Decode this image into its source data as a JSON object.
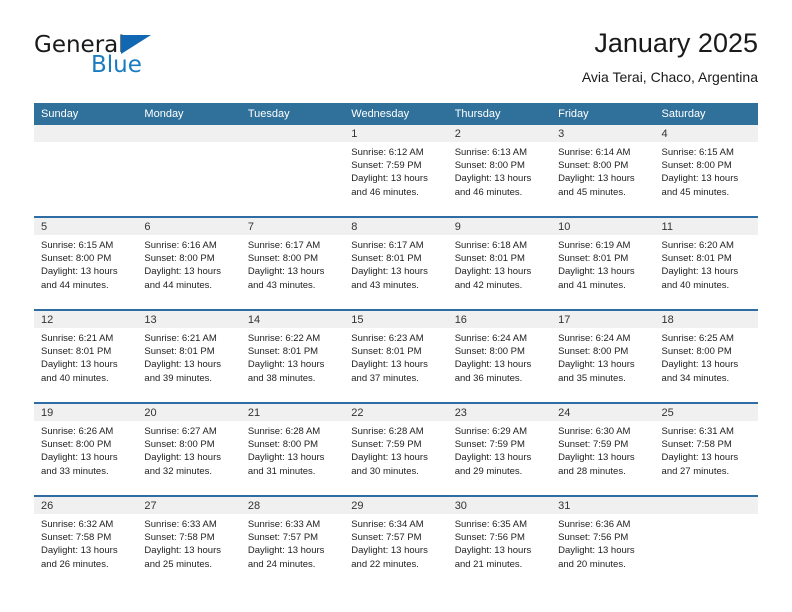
{
  "brand": {
    "name_part1": "General",
    "name_part2": "Blue",
    "accent_color": "#1167b1"
  },
  "header": {
    "title": "January 2025",
    "subtitle": "Avia Terai, Chaco, Argentina"
  },
  "theme": {
    "header_bg": "#30719b",
    "row_divider": "#2e6da4",
    "daynum_bg": "#f0f0f0"
  },
  "weekday_headers": [
    "Sunday",
    "Monday",
    "Tuesday",
    "Wednesday",
    "Thursday",
    "Friday",
    "Saturday"
  ],
  "weeks": [
    [
      {
        "day": "",
        "sunrise": "",
        "sunset": "",
        "daylight_line1": "",
        "daylight_line2": ""
      },
      {
        "day": "",
        "sunrise": "",
        "sunset": "",
        "daylight_line1": "",
        "daylight_line2": ""
      },
      {
        "day": "",
        "sunrise": "",
        "sunset": "",
        "daylight_line1": "",
        "daylight_line2": ""
      },
      {
        "day": "1",
        "sunrise": "Sunrise: 6:12 AM",
        "sunset": "Sunset: 7:59 PM",
        "daylight_line1": "Daylight: 13 hours",
        "daylight_line2": "and 46 minutes."
      },
      {
        "day": "2",
        "sunrise": "Sunrise: 6:13 AM",
        "sunset": "Sunset: 8:00 PM",
        "daylight_line1": "Daylight: 13 hours",
        "daylight_line2": "and 46 minutes."
      },
      {
        "day": "3",
        "sunrise": "Sunrise: 6:14 AM",
        "sunset": "Sunset: 8:00 PM",
        "daylight_line1": "Daylight: 13 hours",
        "daylight_line2": "and 45 minutes."
      },
      {
        "day": "4",
        "sunrise": "Sunrise: 6:15 AM",
        "sunset": "Sunset: 8:00 PM",
        "daylight_line1": "Daylight: 13 hours",
        "daylight_line2": "and 45 minutes."
      }
    ],
    [
      {
        "day": "5",
        "sunrise": "Sunrise: 6:15 AM",
        "sunset": "Sunset: 8:00 PM",
        "daylight_line1": "Daylight: 13 hours",
        "daylight_line2": "and 44 minutes."
      },
      {
        "day": "6",
        "sunrise": "Sunrise: 6:16 AM",
        "sunset": "Sunset: 8:00 PM",
        "daylight_line1": "Daylight: 13 hours",
        "daylight_line2": "and 44 minutes."
      },
      {
        "day": "7",
        "sunrise": "Sunrise: 6:17 AM",
        "sunset": "Sunset: 8:00 PM",
        "daylight_line1": "Daylight: 13 hours",
        "daylight_line2": "and 43 minutes."
      },
      {
        "day": "8",
        "sunrise": "Sunrise: 6:17 AM",
        "sunset": "Sunset: 8:01 PM",
        "daylight_line1": "Daylight: 13 hours",
        "daylight_line2": "and 43 minutes."
      },
      {
        "day": "9",
        "sunrise": "Sunrise: 6:18 AM",
        "sunset": "Sunset: 8:01 PM",
        "daylight_line1": "Daylight: 13 hours",
        "daylight_line2": "and 42 minutes."
      },
      {
        "day": "10",
        "sunrise": "Sunrise: 6:19 AM",
        "sunset": "Sunset: 8:01 PM",
        "daylight_line1": "Daylight: 13 hours",
        "daylight_line2": "and 41 minutes."
      },
      {
        "day": "11",
        "sunrise": "Sunrise: 6:20 AM",
        "sunset": "Sunset: 8:01 PM",
        "daylight_line1": "Daylight: 13 hours",
        "daylight_line2": "and 40 minutes."
      }
    ],
    [
      {
        "day": "12",
        "sunrise": "Sunrise: 6:21 AM",
        "sunset": "Sunset: 8:01 PM",
        "daylight_line1": "Daylight: 13 hours",
        "daylight_line2": "and 40 minutes."
      },
      {
        "day": "13",
        "sunrise": "Sunrise: 6:21 AM",
        "sunset": "Sunset: 8:01 PM",
        "daylight_line1": "Daylight: 13 hours",
        "daylight_line2": "and 39 minutes."
      },
      {
        "day": "14",
        "sunrise": "Sunrise: 6:22 AM",
        "sunset": "Sunset: 8:01 PM",
        "daylight_line1": "Daylight: 13 hours",
        "daylight_line2": "and 38 minutes."
      },
      {
        "day": "15",
        "sunrise": "Sunrise: 6:23 AM",
        "sunset": "Sunset: 8:01 PM",
        "daylight_line1": "Daylight: 13 hours",
        "daylight_line2": "and 37 minutes."
      },
      {
        "day": "16",
        "sunrise": "Sunrise: 6:24 AM",
        "sunset": "Sunset: 8:00 PM",
        "daylight_line1": "Daylight: 13 hours",
        "daylight_line2": "and 36 minutes."
      },
      {
        "day": "17",
        "sunrise": "Sunrise: 6:24 AM",
        "sunset": "Sunset: 8:00 PM",
        "daylight_line1": "Daylight: 13 hours",
        "daylight_line2": "and 35 minutes."
      },
      {
        "day": "18",
        "sunrise": "Sunrise: 6:25 AM",
        "sunset": "Sunset: 8:00 PM",
        "daylight_line1": "Daylight: 13 hours",
        "daylight_line2": "and 34 minutes."
      }
    ],
    [
      {
        "day": "19",
        "sunrise": "Sunrise: 6:26 AM",
        "sunset": "Sunset: 8:00 PM",
        "daylight_line1": "Daylight: 13 hours",
        "daylight_line2": "and 33 minutes."
      },
      {
        "day": "20",
        "sunrise": "Sunrise: 6:27 AM",
        "sunset": "Sunset: 8:00 PM",
        "daylight_line1": "Daylight: 13 hours",
        "daylight_line2": "and 32 minutes."
      },
      {
        "day": "21",
        "sunrise": "Sunrise: 6:28 AM",
        "sunset": "Sunset: 8:00 PM",
        "daylight_line1": "Daylight: 13 hours",
        "daylight_line2": "and 31 minutes."
      },
      {
        "day": "22",
        "sunrise": "Sunrise: 6:28 AM",
        "sunset": "Sunset: 7:59 PM",
        "daylight_line1": "Daylight: 13 hours",
        "daylight_line2": "and 30 minutes."
      },
      {
        "day": "23",
        "sunrise": "Sunrise: 6:29 AM",
        "sunset": "Sunset: 7:59 PM",
        "daylight_line1": "Daylight: 13 hours",
        "daylight_line2": "and 29 minutes."
      },
      {
        "day": "24",
        "sunrise": "Sunrise: 6:30 AM",
        "sunset": "Sunset: 7:59 PM",
        "daylight_line1": "Daylight: 13 hours",
        "daylight_line2": "and 28 minutes."
      },
      {
        "day": "25",
        "sunrise": "Sunrise: 6:31 AM",
        "sunset": "Sunset: 7:58 PM",
        "daylight_line1": "Daylight: 13 hours",
        "daylight_line2": "and 27 minutes."
      }
    ],
    [
      {
        "day": "26",
        "sunrise": "Sunrise: 6:32 AM",
        "sunset": "Sunset: 7:58 PM",
        "daylight_line1": "Daylight: 13 hours",
        "daylight_line2": "and 26 minutes."
      },
      {
        "day": "27",
        "sunrise": "Sunrise: 6:33 AM",
        "sunset": "Sunset: 7:58 PM",
        "daylight_line1": "Daylight: 13 hours",
        "daylight_line2": "and 25 minutes."
      },
      {
        "day": "28",
        "sunrise": "Sunrise: 6:33 AM",
        "sunset": "Sunset: 7:57 PM",
        "daylight_line1": "Daylight: 13 hours",
        "daylight_line2": "and 24 minutes."
      },
      {
        "day": "29",
        "sunrise": "Sunrise: 6:34 AM",
        "sunset": "Sunset: 7:57 PM",
        "daylight_line1": "Daylight: 13 hours",
        "daylight_line2": "and 22 minutes."
      },
      {
        "day": "30",
        "sunrise": "Sunrise: 6:35 AM",
        "sunset": "Sunset: 7:56 PM",
        "daylight_line1": "Daylight: 13 hours",
        "daylight_line2": "and 21 minutes."
      },
      {
        "day": "31",
        "sunrise": "Sunrise: 6:36 AM",
        "sunset": "Sunset: 7:56 PM",
        "daylight_line1": "Daylight: 13 hours",
        "daylight_line2": "and 20 minutes."
      },
      {
        "day": "",
        "sunrise": "",
        "sunset": "",
        "daylight_line1": "",
        "daylight_line2": ""
      }
    ]
  ]
}
